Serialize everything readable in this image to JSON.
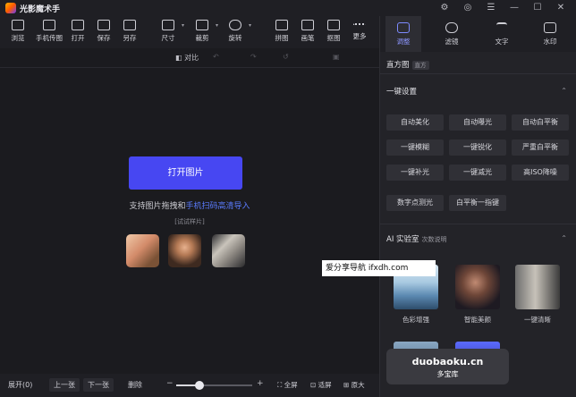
{
  "app": {
    "title": "光影魔术手"
  },
  "window_controls": [
    "⚙",
    "◎",
    "☰",
    "—",
    "☐",
    "✕"
  ],
  "toolbar": {
    "items": [
      {
        "label": "浏览",
        "icon": "folder-icon"
      },
      {
        "label": "手机传图",
        "icon": "phone-transfer-icon"
      },
      {
        "label": "打开",
        "icon": "open-image-icon"
      },
      {
        "label": "保存",
        "icon": "save-icon"
      },
      {
        "label": "另存",
        "icon": "save-as-icon"
      },
      {
        "label": "尺寸",
        "icon": "resize-icon"
      },
      {
        "label": "裁剪",
        "icon": "crop-icon"
      },
      {
        "label": "旋转",
        "icon": "rotate-icon"
      },
      {
        "label": "拼图",
        "icon": "collage-icon"
      },
      {
        "label": "画笔",
        "icon": "brush-icon"
      },
      {
        "label": "抠图",
        "icon": "cutout-icon"
      },
      {
        "label": "更多",
        "icon": "more-icon"
      }
    ],
    "compare_label": "对比"
  },
  "canvas": {
    "open_button": "打开图片",
    "support_text": "支持图片拖拽和",
    "support_link": "手机扫码高清导入",
    "try_sample": "[试试样片]"
  },
  "bottombar": {
    "expand_label": "展开(0)",
    "prev_label": "上一张",
    "next_label": "下一张",
    "delete_label": "删除",
    "fullscreen_label": "全屏",
    "fit_label": "适屏",
    "original_label": "原大",
    "zoom_level": 0.3
  },
  "panel": {
    "tabs": [
      {
        "label": "调整",
        "icon": "sliders-icon",
        "active": true
      },
      {
        "label": "滤镜",
        "icon": "filter-icon",
        "active": false
      },
      {
        "label": "文字",
        "icon": "text-icon",
        "active": false
      },
      {
        "label": "水印",
        "icon": "watermark-icon",
        "active": false
      }
    ],
    "histogram": {
      "title": "直方图",
      "tag": "直方"
    },
    "oneclick": {
      "title": "一键设置",
      "buttons": [
        "自动美化",
        "自动曝光",
        "自动白平衡",
        "一键模糊",
        "一键锐化",
        "严重白平衡",
        "一键补光",
        "一键减光",
        "高ISO降噪",
        "数字点测光",
        "白平衡一指键"
      ]
    },
    "ai_lab": {
      "title": "AI 实验室",
      "sub": "次数说明",
      "cards": [
        "色彩增强",
        "智能美颜",
        "一键清晰"
      ]
    }
  },
  "overlays": {
    "watermark_top": "爱分享导航  ifxdh.com",
    "watermark_bottom_a": "duobaoku.cn",
    "watermark_bottom_b": "多宝库"
  }
}
